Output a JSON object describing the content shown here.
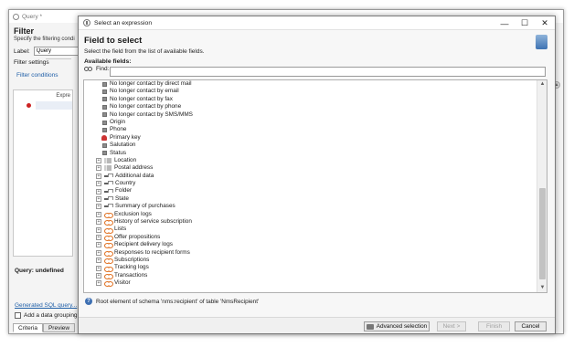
{
  "bg": {
    "window_title": "Query *",
    "filter_title": "Filter",
    "filter_sub": "Specify the filtering condi",
    "label_text": "Label:",
    "label_value": "Query",
    "settings": "Filter settings",
    "conditions_link": "Filter conditions",
    "expr_head": "Expre",
    "query_status": "Query: undefined",
    "sql_link": "Generated SQL query...",
    "group_label": "Add a data grouping c",
    "tabs": [
      "Criteria",
      "Preview"
    ]
  },
  "dialog": {
    "title": "Select an expression",
    "header_title": "Field to select",
    "header_sub": "Select the field from the list of available fields.",
    "available_label": "Available fields:",
    "find_label": "Find:",
    "find_value": "",
    "status_text": "Root element of schema 'nms:recipient' of table 'NmsRecipient'",
    "buttons": {
      "advanced": "Advanced selection",
      "next": "Next >",
      "finish": "Finish",
      "cancel": "Cancel"
    },
    "tree": [
      {
        "label": "No longer contact by direct mail",
        "kind": "leaf",
        "icon": "field-icon"
      },
      {
        "label": "No longer contact by email",
        "kind": "leaf",
        "icon": "field-icon"
      },
      {
        "label": "No longer contact by fax",
        "kind": "leaf",
        "icon": "field-icon"
      },
      {
        "label": "No longer contact by phone",
        "kind": "leaf",
        "icon": "field-icon"
      },
      {
        "label": "No longer contact by SMS/MMS",
        "kind": "leaf",
        "icon": "field-icon"
      },
      {
        "label": "Origin",
        "kind": "leaf",
        "icon": "field-icon"
      },
      {
        "label": "Phone",
        "kind": "leaf",
        "icon": "field-icon"
      },
      {
        "label": "Primary key",
        "kind": "leaf",
        "icon": "key-icon"
      },
      {
        "label": "Salutation",
        "kind": "leaf",
        "icon": "field-icon"
      },
      {
        "label": "Status",
        "kind": "leaf",
        "icon": "field-icon"
      },
      {
        "label": "Location",
        "kind": "node",
        "icon": "element-icon"
      },
      {
        "label": "Postal address",
        "kind": "node",
        "icon": "element-icon"
      },
      {
        "label": "Additional data",
        "kind": "node",
        "icon": "sql-link-icon"
      },
      {
        "label": "Country",
        "kind": "node",
        "icon": "sql-link-icon"
      },
      {
        "label": "Folder",
        "kind": "node",
        "icon": "sql-link-icon"
      },
      {
        "label": "State",
        "kind": "node",
        "icon": "sql-link-icon"
      },
      {
        "label": "Summary of purchases",
        "kind": "node",
        "icon": "sql-link-icon"
      },
      {
        "label": "Exclusion logs",
        "kind": "node",
        "icon": "collection-link-icon"
      },
      {
        "label": "History of service subscription",
        "kind": "node",
        "icon": "collection-link-icon"
      },
      {
        "label": "Lists",
        "kind": "node",
        "icon": "collection-link-icon"
      },
      {
        "label": "Offer propositions",
        "kind": "node",
        "icon": "collection-link-icon"
      },
      {
        "label": "Recipient delivery logs",
        "kind": "node",
        "icon": "collection-link-icon"
      },
      {
        "label": "Responses to recipient forms",
        "kind": "node",
        "icon": "collection-link-icon"
      },
      {
        "label": "Subscriptions",
        "kind": "node",
        "icon": "collection-link-icon"
      },
      {
        "label": "Tracking logs",
        "kind": "node",
        "icon": "collection-link-icon"
      },
      {
        "label": "Transactions",
        "kind": "node",
        "icon": "collection-link-icon"
      },
      {
        "label": "Visitor",
        "kind": "node",
        "icon": "collection-link-icon"
      }
    ]
  }
}
